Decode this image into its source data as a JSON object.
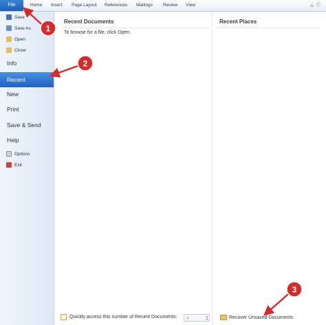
{
  "ribbon": {
    "file_tab": "File",
    "tabs": [
      "Home",
      "Insert",
      "Page Layout",
      "References",
      "Mailings",
      "Review",
      "View"
    ]
  },
  "backstage": {
    "small_items": [
      {
        "label": "Save",
        "icon": "save-icon"
      },
      {
        "label": "Save As",
        "icon": "save-as-icon"
      },
      {
        "label": "Open",
        "icon": "open-folder-icon"
      },
      {
        "label": "Close",
        "icon": "close-folder-icon"
      }
    ],
    "info": "Info",
    "recent": "Recent",
    "new": "New",
    "print": "Print",
    "save_send": "Save & Send",
    "help": "Help",
    "options": "Options",
    "exit": "Exit"
  },
  "recent_documents": {
    "title": "Recent Documents",
    "hint": "To browse for a file, click Open."
  },
  "recent_places": {
    "title": "Recent Places"
  },
  "footer": {
    "quick_access_label": "Quickly access this number of Recent Documents:",
    "quick_access_value": "4",
    "recover_label": "Recover Unsaved Documents"
  },
  "annotations": {
    "badge_1": "1",
    "badge_2": "2",
    "badge_3": "3",
    "color": "#d62b2b"
  }
}
